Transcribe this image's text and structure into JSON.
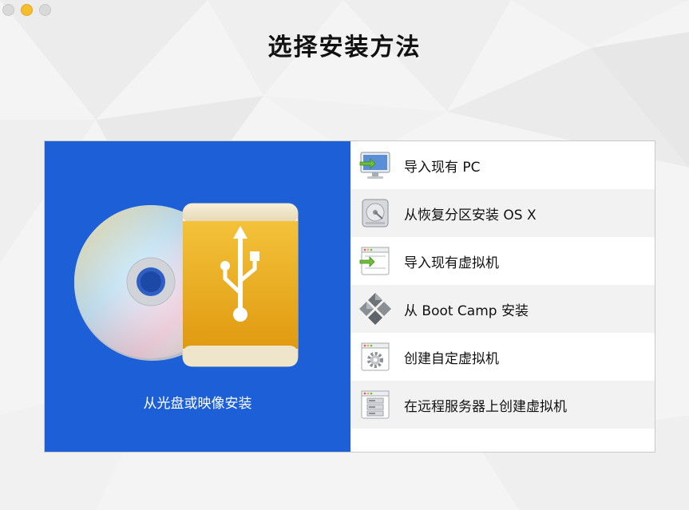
{
  "window": {
    "title": "选择安装方法",
    "controls": [
      "close",
      "minimize",
      "zoom"
    ]
  },
  "colors": {
    "accent_blue": "#1c5fd6",
    "usb_orange": "#e9a317",
    "row_alt": "#f2f2f2"
  },
  "install_disc": {
    "label": "从光盘或映像安装",
    "icons": [
      "disc-icon",
      "usb-drive-icon"
    ]
  },
  "methods": [
    {
      "label": "导入现有 PC",
      "icon": "monitor-import-icon"
    },
    {
      "label": "从恢复分区安装 OS X",
      "icon": "hard-drive-icon"
    },
    {
      "label": "导入现有虚拟机",
      "icon": "window-import-icon"
    },
    {
      "label": "从 Boot Camp 安装",
      "icon": "bootcamp-icon"
    },
    {
      "label": "创建自定虚拟机",
      "icon": "window-gear-icon"
    },
    {
      "label": "在远程服务器上创建虚拟机",
      "icon": "window-server-icon"
    }
  ]
}
